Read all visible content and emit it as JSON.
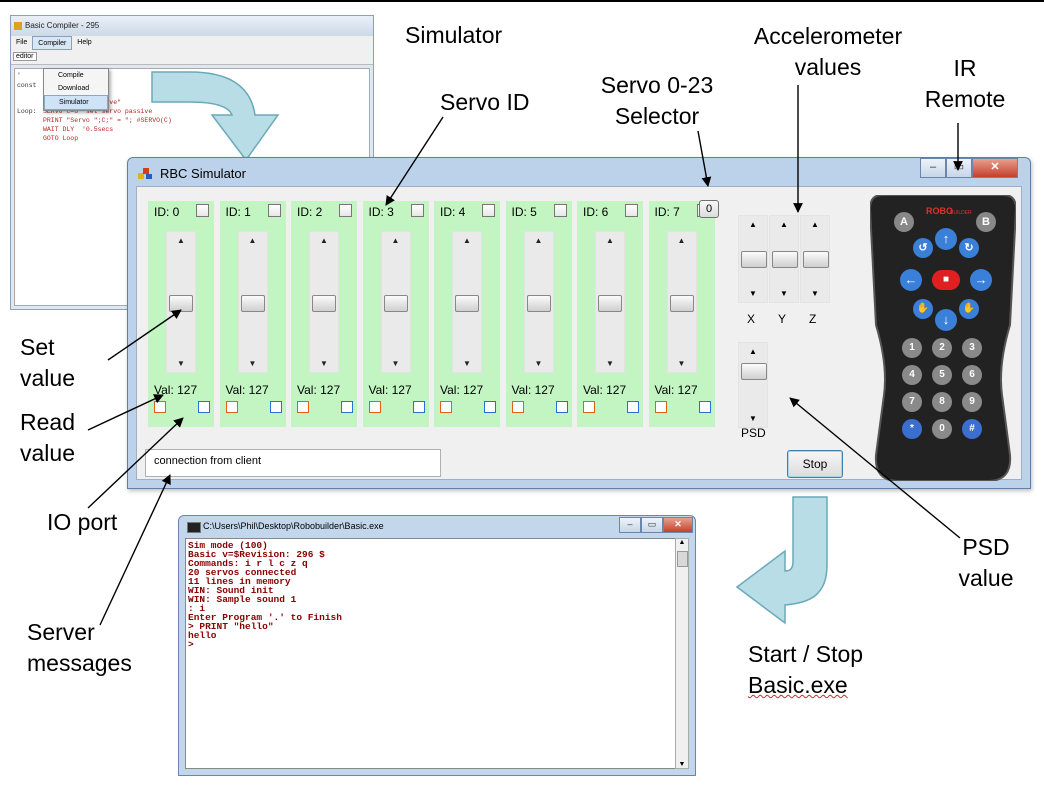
{
  "annotations": {
    "simulator": "Simulator",
    "servo_id": "Servo ID",
    "servo_selector": [
      "Servo 0-23",
      "Selector"
    ],
    "accelerometer": [
      "Accelerometer",
      "values"
    ],
    "ir_remote": [
      "IR",
      "Remote"
    ],
    "set_value": [
      "Set",
      "value"
    ],
    "read_value": [
      "Read",
      "value"
    ],
    "io_port": "IO port",
    "server_messages": [
      "Server",
      "messages"
    ],
    "psd_value": [
      "PSD",
      "value"
    ],
    "start_stop": [
      "Start / Stop",
      "Basic.exe"
    ]
  },
  "compiler_window": {
    "title": "Basic Compiler - 295",
    "menu": [
      "File",
      "Compiler",
      "Help"
    ],
    "toolbar_label": "editor",
    "dropdown": [
      "Compile",
      "Download",
      "Simulator"
    ],
    "code_labels": [
      "'",
      "const",
      "Loop:"
    ],
    "code_lines": [
      "PRINT \"Test Passive\"",
      "SERVO C=8 'set servo passive",
      "PRINT \"Servo \";C;\" = \"; #SERVO(C)",
      "WAIT DLY  '0.5secs",
      "GOTO Loop"
    ]
  },
  "simulator": {
    "title": "RBC Simulator",
    "servos": [
      {
        "id": "ID: 0",
        "val": "Val: 127",
        "level": 0.5
      },
      {
        "id": "ID: 1",
        "val": "Val: 127",
        "level": 0.5
      },
      {
        "id": "ID: 2",
        "val": "Val: 127",
        "level": 0.5
      },
      {
        "id": "ID: 3",
        "val": "Val: 127",
        "level": 0.5
      },
      {
        "id": "ID: 4",
        "val": "Val: 127",
        "level": 0.5
      },
      {
        "id": "ID: 5",
        "val": "Val: 127",
        "level": 0.5
      },
      {
        "id": "ID: 6",
        "val": "Val: 127",
        "level": 0.5
      },
      {
        "id": "ID: 7",
        "val": "Val: 127",
        "level": 0.5
      }
    ],
    "selector_value": "0",
    "accel_labels": [
      "X",
      "Y",
      "Z"
    ],
    "psd_label": "PSD",
    "stop_label": "Stop",
    "server_message": "connection from client"
  },
  "remote": {
    "brand": "ROBO",
    "brand_suffix": "BUILDER",
    "top_buttons": [
      "A",
      "B"
    ],
    "number_keys": [
      "1",
      "2",
      "3",
      "4",
      "5",
      "6",
      "7",
      "8",
      "9",
      "*",
      "0",
      "#"
    ]
  },
  "console": {
    "title": "C:\\Users\\Phil\\Desktop\\Robobuilder\\Basic.exe",
    "lines": [
      "Sim mode (100)",
      "Basic v=$Revision: 296 $",
      "Commands: i r l c z q",
      "20 servos connected",
      "11 lines in memory",
      "WIN: Sound init",
      "WIN: Sample sound 1",
      ": i",
      "Enter Program '.' to Finish",
      "> PRINT \"hello\"",
      "hello",
      ">"
    ]
  },
  "colors": {
    "servo_panel": "#c3f5c3",
    "io_out": "#e06018",
    "io_in": "#2a6fd4",
    "console_text": "#8b0000",
    "flow_arrow": "#b8dde6"
  }
}
